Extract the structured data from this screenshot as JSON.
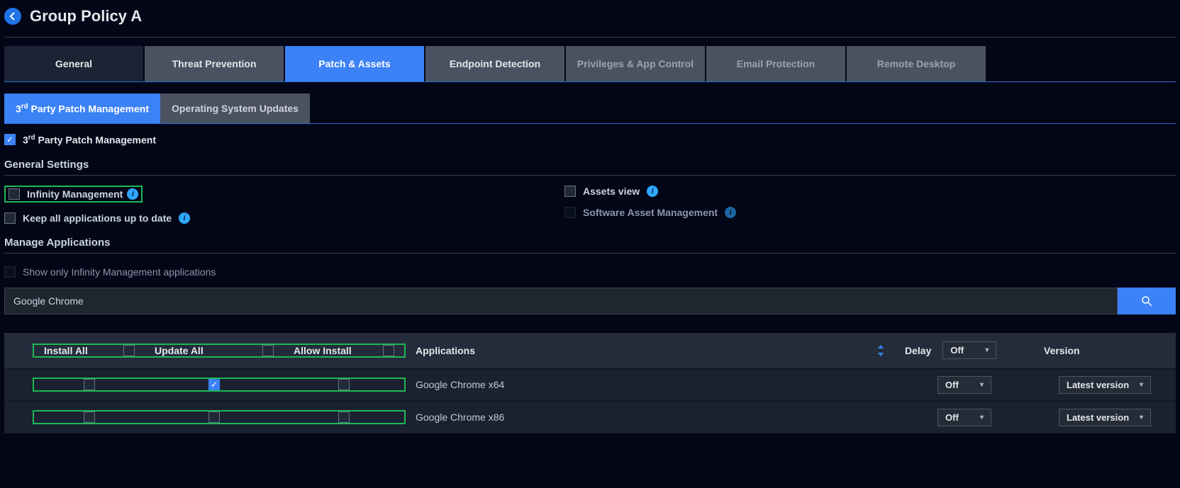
{
  "header": {
    "title": "Group Policy A"
  },
  "tabs": {
    "items": [
      {
        "label": "General"
      },
      {
        "label": "Threat Prevention"
      },
      {
        "label": "Patch & Assets"
      },
      {
        "label": "Endpoint Detection"
      },
      {
        "label": "Privileges & App Control"
      },
      {
        "label": "Email Protection"
      },
      {
        "label": "Remote Desktop"
      }
    ]
  },
  "subtabs": {
    "items": [
      {
        "label_pre": "3",
        "label_sup": "rd",
        "label_post": " Party Patch Management"
      },
      {
        "label": "Operating System Updates"
      }
    ]
  },
  "enable_row": {
    "label_pre": "3",
    "label_sup": "rd",
    "label_post": " Party Patch Management"
  },
  "sections": {
    "general": "General Settings",
    "manage": "Manage Applications"
  },
  "settings": {
    "infinity": "Infinity Management",
    "keep_all": "Keep all applications up to date",
    "assets_view": "Assets view",
    "sam": "Software Asset Management",
    "show_only": "Show only Infinity Management applications"
  },
  "search": {
    "value": "Google Chrome"
  },
  "table": {
    "headers": {
      "install_all": "Install All",
      "update_all": "Update All",
      "allow_install": "Allow Install",
      "applications": "Applications",
      "delay": "Delay",
      "version": "Version"
    },
    "delay_dropdown": "Off",
    "rows": [
      {
        "app": "Google Chrome x64",
        "install": false,
        "update": true,
        "allow": false,
        "delay": "Off",
        "version": "Latest version"
      },
      {
        "app": "Google Chrome x86",
        "install": false,
        "update": false,
        "allow": false,
        "delay": "Off",
        "version": "Latest version"
      }
    ]
  }
}
